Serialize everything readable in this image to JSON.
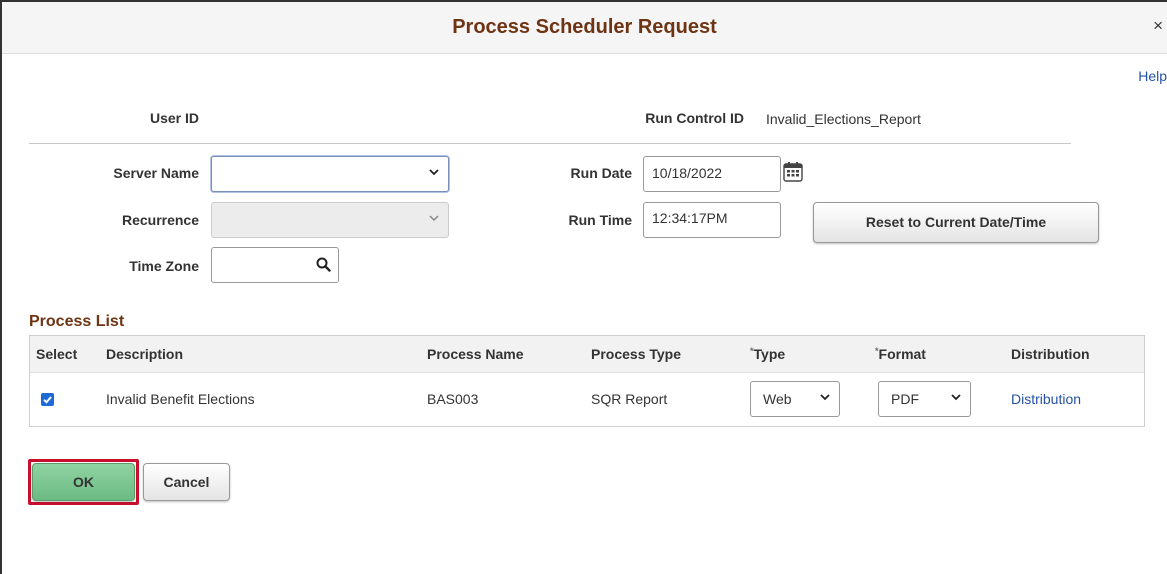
{
  "dialog": {
    "title": "Process Scheduler Request",
    "close_glyph": "×",
    "help_label": "Help"
  },
  "form": {
    "user_id_label": "User ID",
    "user_id_value": "",
    "run_control_label": "Run Control ID",
    "run_control_value": "Invalid_Elections_Report",
    "server_name_label": "Server Name",
    "server_name_value": "",
    "recurrence_label": "Recurrence",
    "recurrence_value": "",
    "time_zone_label": "Time Zone",
    "time_zone_value": "",
    "run_date_label": "Run Date",
    "run_date_value": "10/18/2022",
    "run_time_label": "Run Time",
    "run_time_value": "12:34:17PM",
    "reset_button_label": "Reset to Current Date/Time"
  },
  "process_list": {
    "title": "Process List",
    "columns": {
      "select": "Select",
      "description": "Description",
      "process_name": "Process Name",
      "process_type": "Process Type",
      "type": "Type",
      "format": "Format",
      "distribution": "Distribution"
    },
    "required_marker": "*",
    "rows": [
      {
        "selected": true,
        "description": "Invalid Benefit Elections",
        "process_name": "BAS003",
        "process_type": "SQR Report",
        "type": "Web",
        "format": "PDF",
        "distribution": "Distribution"
      }
    ]
  },
  "actions": {
    "ok_label": "OK",
    "cancel_label": "Cancel"
  },
  "colors": {
    "title": "#6e3414",
    "link": "#2552a8",
    "ok_button": "#7ac48f",
    "ok_highlight": "#c8102e",
    "checkbox": "#1e6ad6"
  },
  "icons": {
    "close": "close-icon",
    "calendar": "calendar-icon",
    "search": "search-icon",
    "chevron": "chevron-down-icon",
    "check": "check-icon"
  }
}
